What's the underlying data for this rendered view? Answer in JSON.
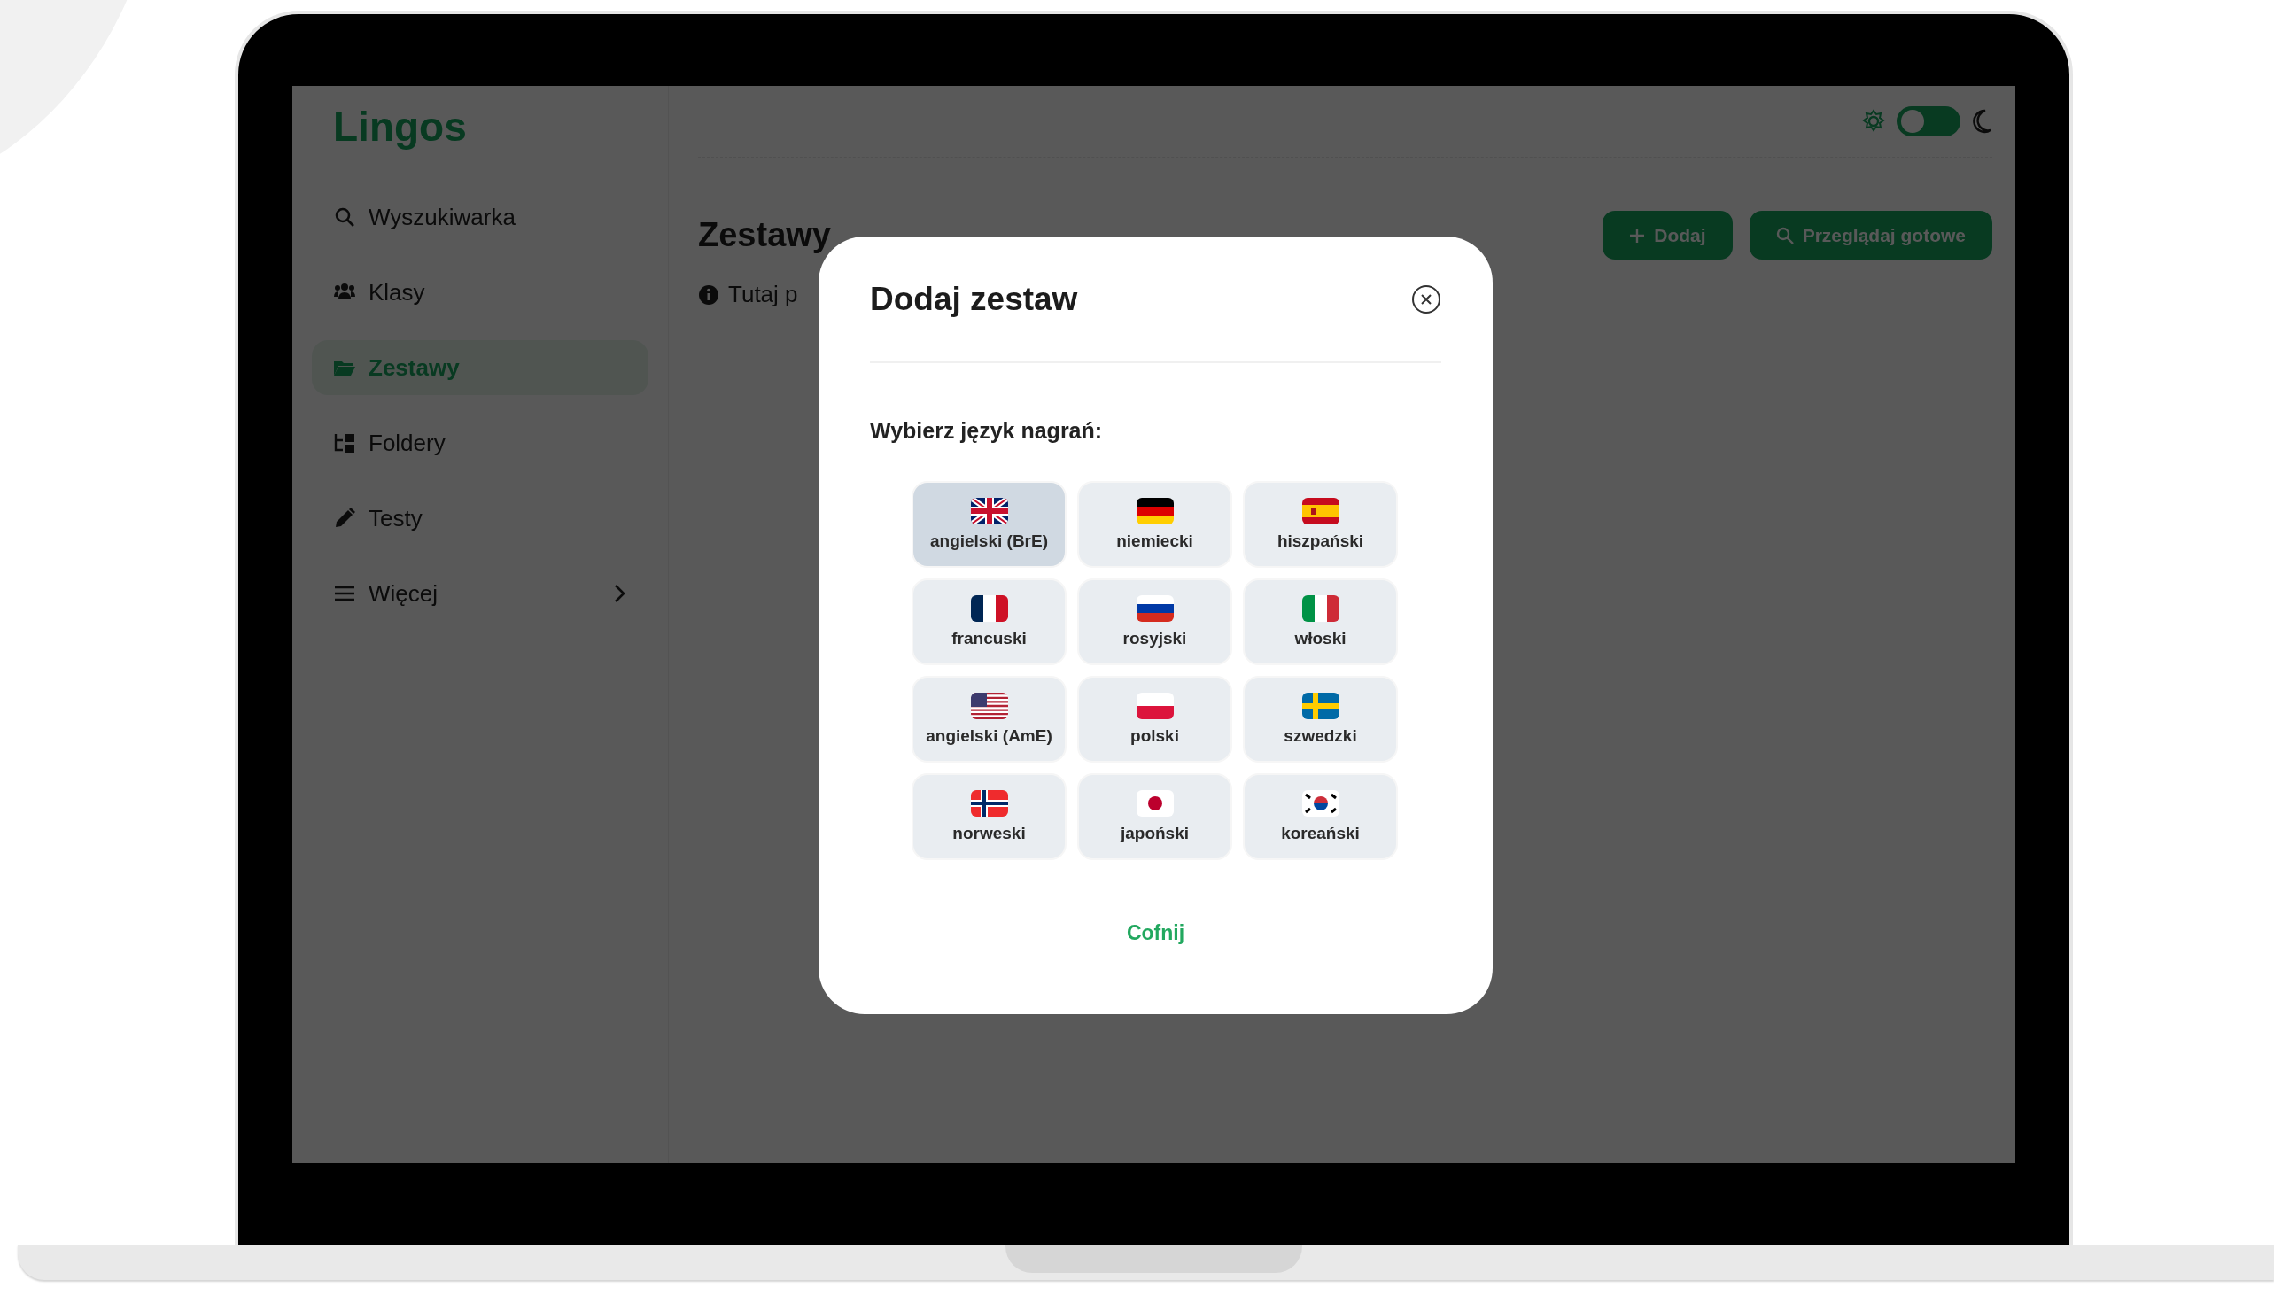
{
  "app": {
    "logo": "Lingos",
    "dark_mode": false
  },
  "sidebar": {
    "items": [
      {
        "label": "Wyszukiwarka",
        "selected": false,
        "has_submenu": false
      },
      {
        "label": "Klasy",
        "selected": false,
        "has_submenu": false
      },
      {
        "label": "Zestawy",
        "selected": true,
        "has_submenu": false
      },
      {
        "label": "Foldery",
        "selected": false,
        "has_submenu": false
      },
      {
        "label": "Testy",
        "selected": false,
        "has_submenu": false
      },
      {
        "label": "Więcej",
        "selected": false,
        "has_submenu": true
      }
    ]
  },
  "main": {
    "title": "Zestawy",
    "info": "Tutaj p",
    "buttons": [
      {
        "label": "Dodaj",
        "kind": "add"
      },
      {
        "label": "Przeglądaj gotowe",
        "kind": "browse"
      }
    ]
  },
  "dialog": {
    "title": "Dodaj zestaw",
    "prompt": "Wybierz język nagrań:",
    "cancel": "Cofnij",
    "languages": [
      {
        "label": "angielski (BrE)",
        "selected": true
      },
      {
        "label": "niemiecki",
        "selected": false
      },
      {
        "label": "hiszpański",
        "selected": false
      },
      {
        "label": "francuski",
        "selected": false
      },
      {
        "label": "rosyjski",
        "selected": false
      },
      {
        "label": "włoski",
        "selected": false
      },
      {
        "label": "angielski (AmE)",
        "selected": false
      },
      {
        "label": "polski",
        "selected": false
      },
      {
        "label": "szwedzki",
        "selected": false
      },
      {
        "label": "norweski",
        "selected": false
      },
      {
        "label": "japoński",
        "selected": false
      },
      {
        "label": "koreański",
        "selected": false
      }
    ]
  }
}
